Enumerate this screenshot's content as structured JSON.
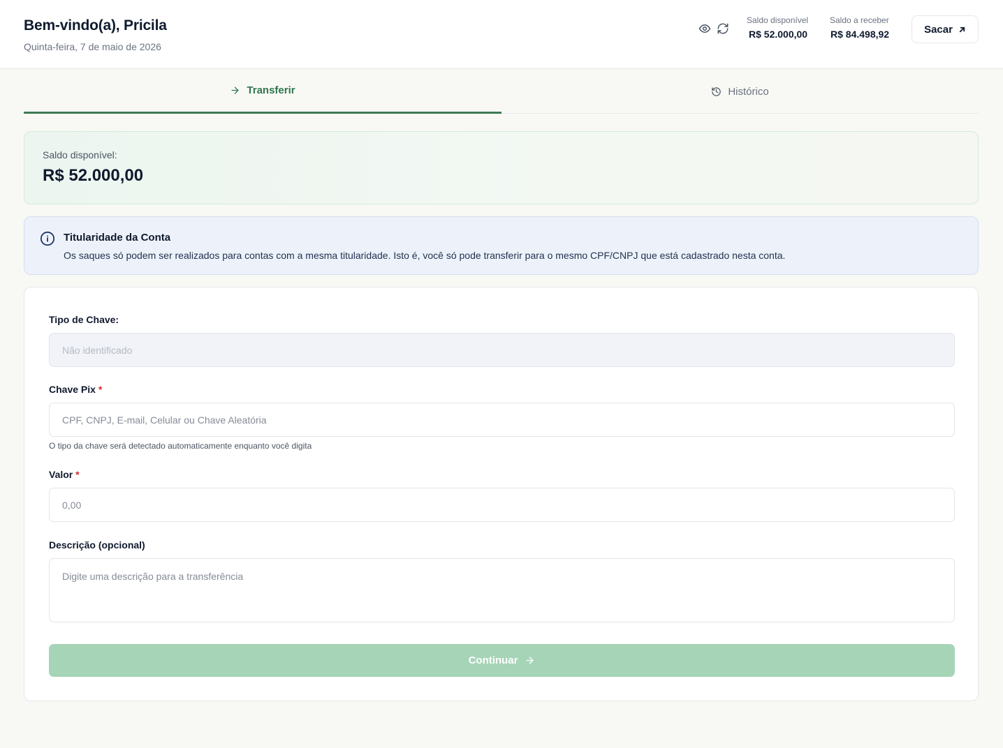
{
  "header": {
    "greeting": "Bem-vindo(a), Pricila",
    "date": "Quinta-feira, 7 de maio de 2026",
    "available_label": "Saldo disponível",
    "available_value": "R$ 52.000,00",
    "receivable_label": "Saldo a receber",
    "receivable_value": "R$ 84.498,92",
    "withdraw_label": "Sacar",
    "icons": [
      "eye-icon",
      "refresh-icon",
      "arrow-up-right-icon"
    ]
  },
  "tabs": [
    {
      "label": "Transferir",
      "icon": "arrow-right-icon",
      "active": true
    },
    {
      "label": "Histórico",
      "icon": "history-icon",
      "active": false
    }
  ],
  "balance_card": {
    "label": "Saldo disponível:",
    "value": "R$ 52.000,00"
  },
  "alert": {
    "icon": "info-icon",
    "title": "Titularidade da Conta",
    "text": "Os saques só podem ser realizados para contas com a mesma titularidade. Isto é, você só pode transferir para o mesmo CPF/CNPJ que está cadastrado nesta conta."
  },
  "form": {
    "key_type_label": "Tipo de Chave:",
    "key_type_placeholder": "Não identificado",
    "pix_key_label": "Chave Pix",
    "pix_key_placeholder": "CPF, CNPJ, E-mail, Celular ou Chave Aleatória",
    "pix_key_hint": "O tipo da chave será detectado automaticamente enquanto você digita",
    "amount_label": "Valor",
    "amount_placeholder": "0,00",
    "description_label": "Descrição (opcional)",
    "description_placeholder": "Digite uma descrição para a transferência",
    "required_mark": "*",
    "continue_label": "Continuar"
  },
  "colors": {
    "brand_green": "#2f7550",
    "button_disabled": "#a6d4b6",
    "required": "#dc2626",
    "info_bg": "#edf2fa"
  }
}
